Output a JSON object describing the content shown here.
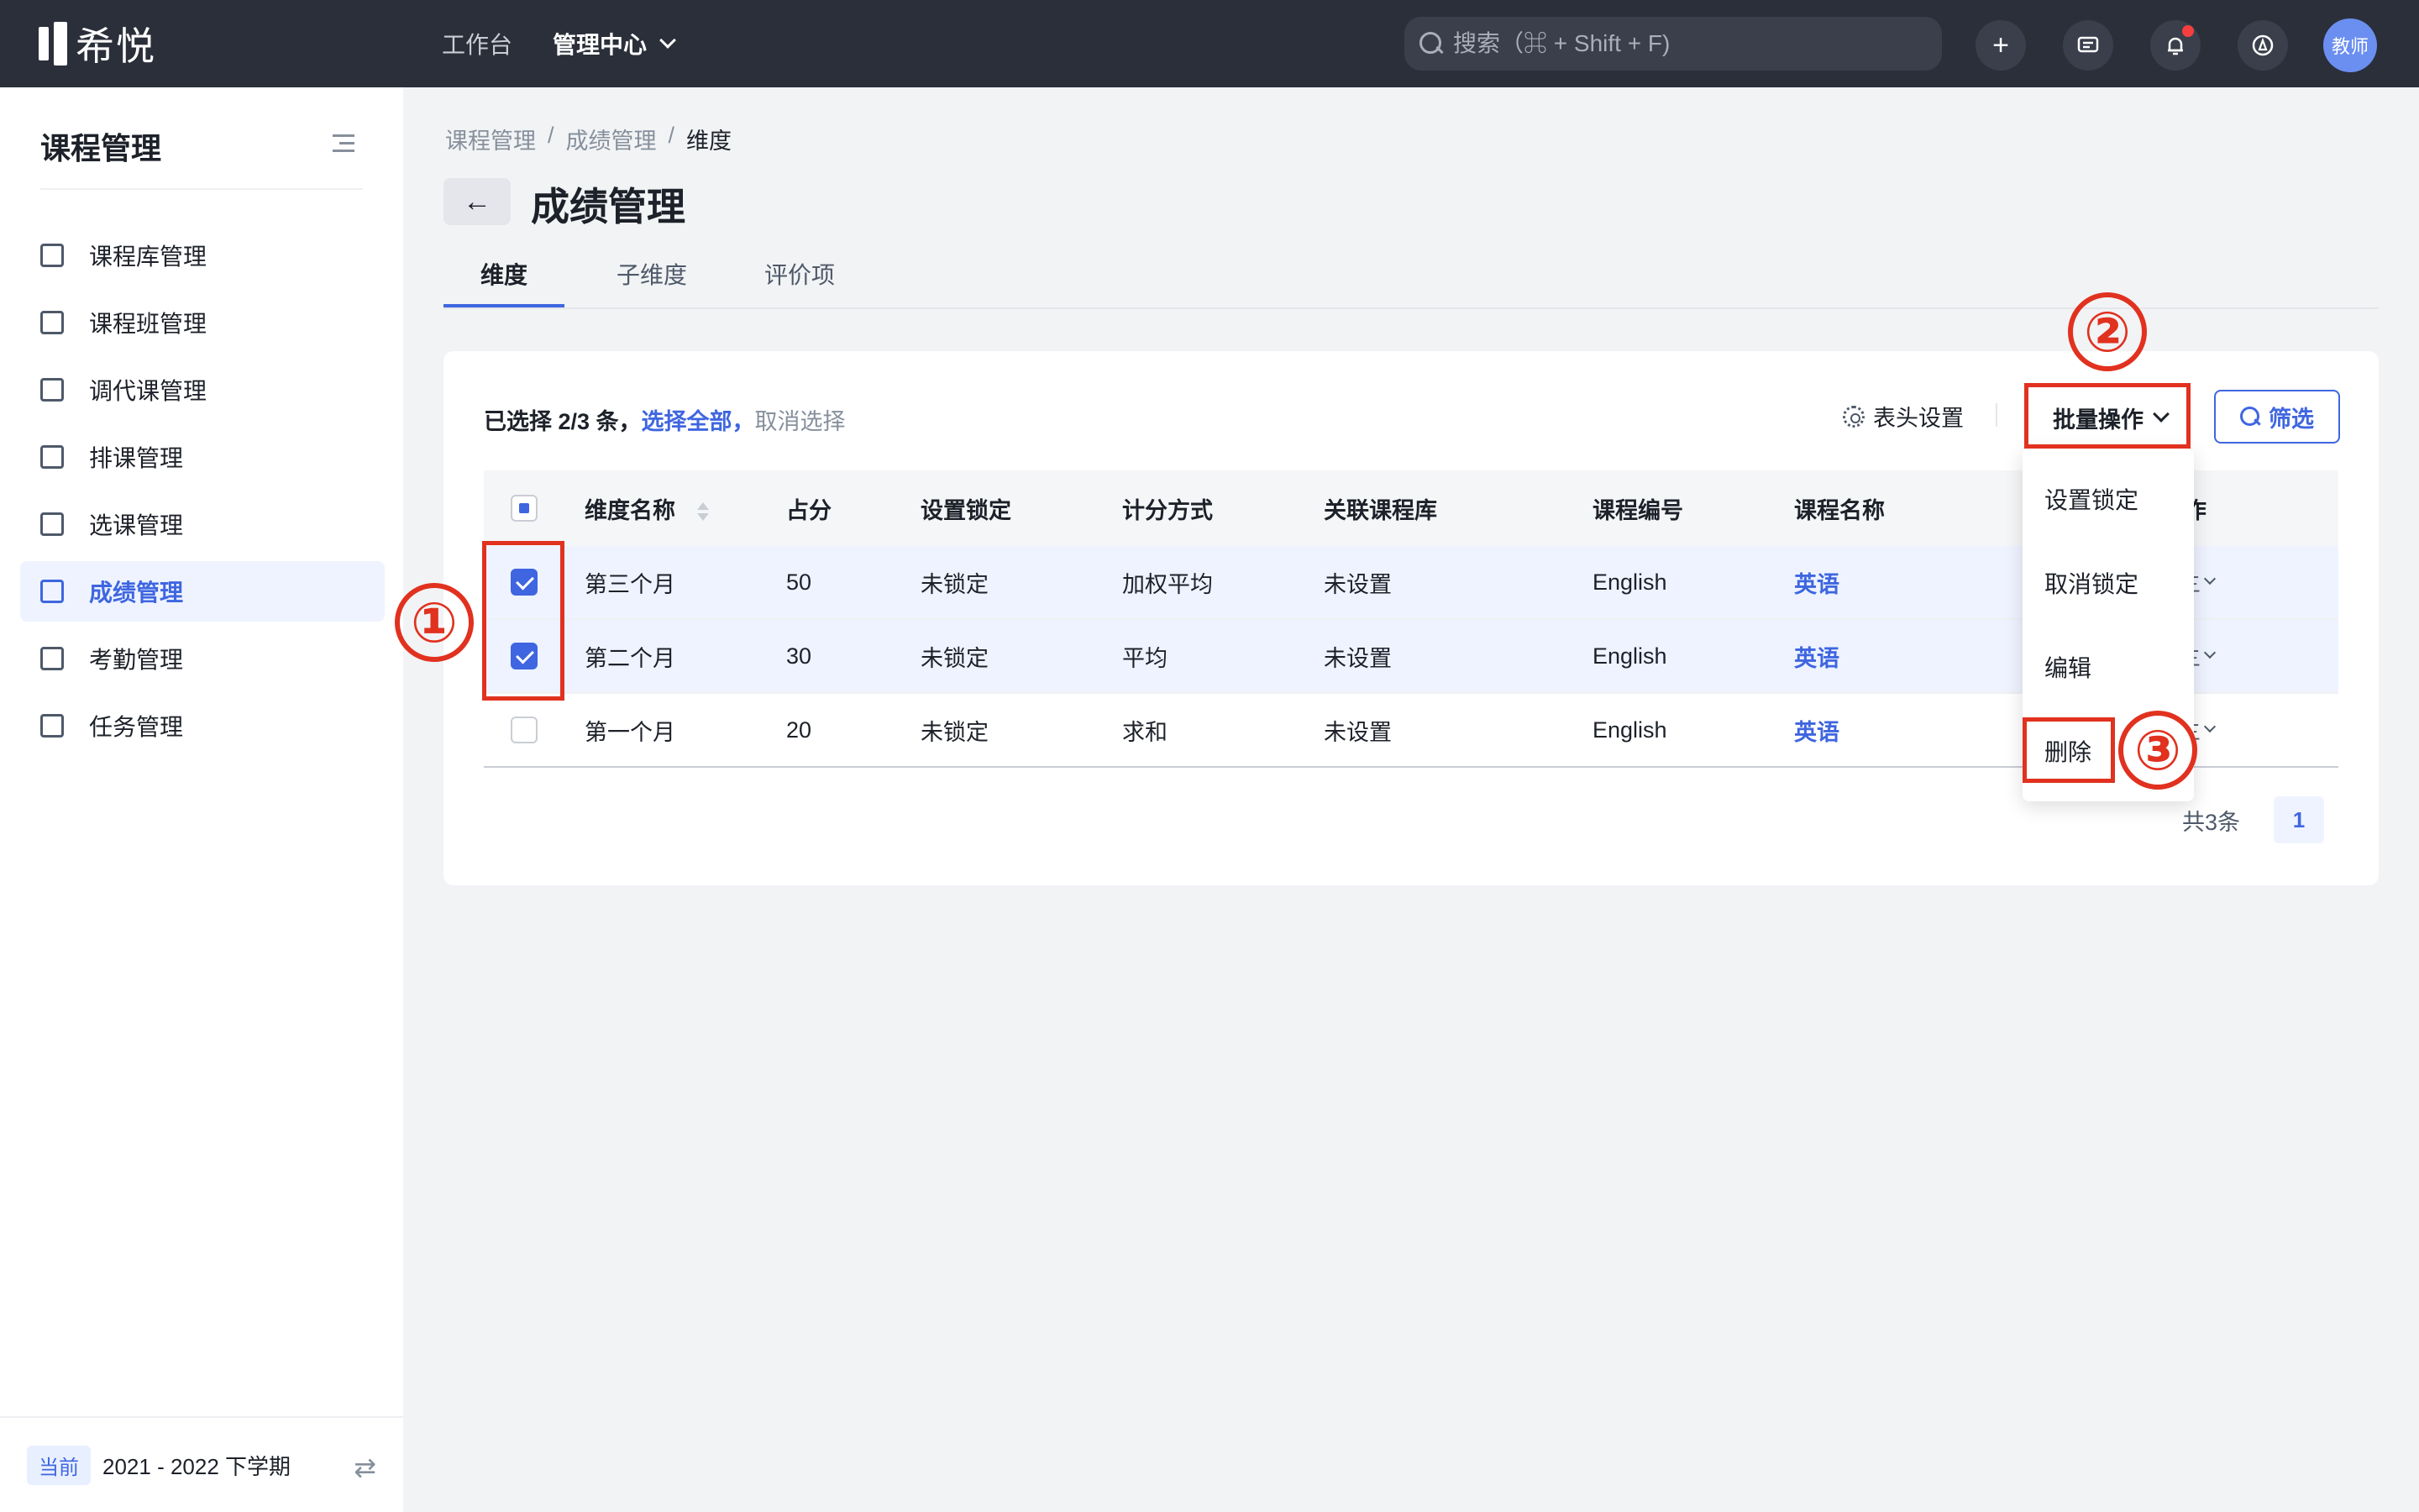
{
  "topbar": {
    "logo_text": "希悦",
    "nav": [
      "工作台",
      "管理中心"
    ],
    "search_placeholder": "搜索（⌘ + Shift + F)",
    "add_icon": "+",
    "avatar_label": "教师",
    "notification_badge_color": "#f53f3f"
  },
  "sidebar": {
    "title": "课程管理",
    "items": [
      {
        "label": "课程库管理",
        "icon": "list-icon"
      },
      {
        "label": "课程班管理",
        "icon": "class-icon"
      },
      {
        "label": "调代课管理",
        "icon": "swap-course-icon"
      },
      {
        "label": "排课管理",
        "icon": "schedule-icon"
      },
      {
        "label": "选课管理",
        "icon": "check-course-icon"
      },
      {
        "label": "成绩管理",
        "icon": "grade-icon",
        "active": true
      },
      {
        "label": "考勤管理",
        "icon": "calendar-icon"
      },
      {
        "label": "任务管理",
        "icon": "task-icon"
      }
    ],
    "footer": {
      "tag": "当前",
      "term": "2021 - 2022 下学期"
    }
  },
  "breadcrumb": [
    "课程管理",
    "/",
    "成绩管理",
    "/",
    "维度"
  ],
  "page_title": "成绩管理",
  "tabs": [
    "维度",
    "子维度",
    "评价项"
  ],
  "selection": {
    "prefix": "已选择 2/3 条，",
    "select_all": "选择全部，",
    "cancel": "取消选择"
  },
  "toolbar": {
    "header_settings": "表头设置",
    "batch": "批量操作",
    "filter": "筛选"
  },
  "table": {
    "columns": [
      "维度名称",
      "占分",
      "设置锁定",
      "计分方式",
      "关联课程库",
      "课程编号",
      "课程名称",
      "作"
    ],
    "rows": [
      {
        "name": "第三个月",
        "score": "50",
        "lock": "未锁定",
        "method": "加权平均",
        "lib": "未设置",
        "code": "English",
        "course": "英语",
        "checked": true
      },
      {
        "name": "第二个月",
        "score": "30",
        "lock": "未锁定",
        "method": "平均",
        "lib": "未设置",
        "code": "English",
        "course": "英语",
        "checked": true
      },
      {
        "name": "第一个月",
        "score": "20",
        "lock": "未锁定",
        "method": "求和",
        "lib": "未设置",
        "code": "English",
        "course": "英语",
        "checked": false
      }
    ],
    "row_action": "三"
  },
  "pager": {
    "total": "共3条",
    "page": "1"
  },
  "dropdown": [
    "设置锁定",
    "取消锁定",
    "编辑",
    "删除"
  ],
  "annotations": [
    "①",
    "②",
    "③"
  ],
  "colors": {
    "accent": "#3f66e0",
    "annotation": "#e1311f",
    "topbar": "#2b2f3a"
  }
}
